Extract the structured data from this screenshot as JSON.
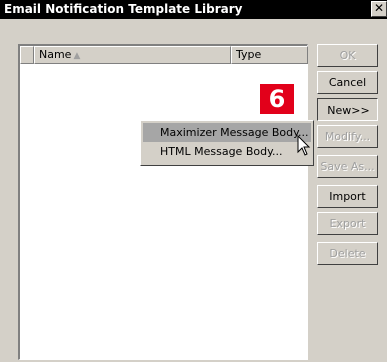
{
  "window": {
    "title": "Email Notification Template Library",
    "close_glyph": "✕"
  },
  "list": {
    "columns": [
      {
        "label": "Name",
        "sort_glyph": "▲"
      },
      {
        "label": "Type"
      }
    ],
    "rows": []
  },
  "buttons": {
    "ok": "OK",
    "cancel": "Cancel",
    "new": "New>>",
    "modify": "Modify...",
    "save_as": "Save As...",
    "import": "Import",
    "export": "Export",
    "delete": "Delete"
  },
  "popup_menu": {
    "items": [
      {
        "label": "Maximizer Message Body...",
        "highlighted": true
      },
      {
        "label": "HTML Message Body...",
        "highlighted": false
      }
    ]
  },
  "callout": {
    "label": "6",
    "color": "#e2001a"
  }
}
